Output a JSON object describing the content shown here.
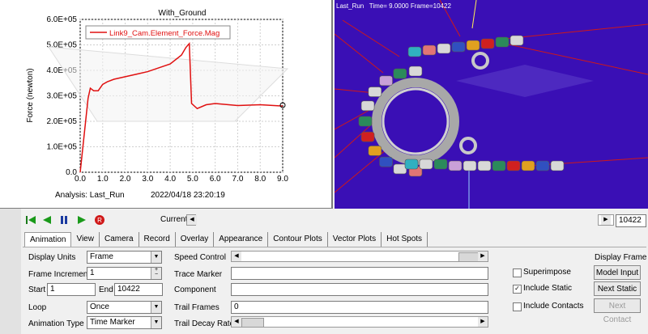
{
  "chart_data": {
    "type": "line",
    "title": "With_Ground",
    "xlabel": "",
    "ylabel": "Force (newton)",
    "xlim": [
      0,
      9
    ],
    "ylim": [
      0,
      600000
    ],
    "x_ticks": [
      "0.0",
      "1.0",
      "2.0",
      "3.0",
      "4.0",
      "5.0",
      "6.0",
      "7.0",
      "8.0",
      "9.0"
    ],
    "y_ticks": [
      "0.0",
      "1.0E+05",
      "2.0E+05",
      "3.0E+05",
      "4.0E+05",
      "5.0E+05",
      "6.0E+05"
    ],
    "legend": "top-left",
    "series": [
      {
        "name": "Link9_Cam.Element_Force.Mag",
        "x": [
          0.0,
          0.35,
          0.45,
          0.6,
          0.8,
          1.0,
          1.2,
          1.5,
          2.0,
          2.5,
          3.0,
          3.5,
          4.0,
          4.5,
          4.7,
          4.85,
          4.95,
          5.2,
          5.6,
          6.0,
          7.0,
          8.0,
          9.0
        ],
        "values": [
          0,
          290000,
          330000,
          320000,
          320000,
          345000,
          355000,
          365000,
          375000,
          385000,
          395000,
          410000,
          425000,
          460000,
          490000,
          505000,
          270000,
          250000,
          265000,
          270000,
          262000,
          265000,
          260000
        ]
      }
    ],
    "color": "#e01010"
  },
  "plot": {
    "analysis_label": "Analysis:  Last_Run",
    "timestamp": "2022-04-18 23:20:19",
    "timestamp_display": "2022/04/18 23:20:19"
  },
  "viewport": {
    "run_label": "Last_Run",
    "time_label": "Time=  9.0000",
    "frame_label": "Frame=10422"
  },
  "toolbar": {
    "current_label": "Current",
    "frame_value": "10422"
  },
  "tabs": [
    "Animation",
    "View",
    "Camera",
    "Record",
    "Overlay",
    "Appearance",
    "Contour Plots",
    "Vector Plots",
    "Hot Spots"
  ],
  "form": {
    "display_units_label": "Display Units",
    "display_units_value": "Frame",
    "frame_increment_label": "Frame Increment",
    "frame_increment_value": "1",
    "start_label": "Start",
    "start_value": "1",
    "end_label": "End",
    "end_value": "10422",
    "loop_label": "Loop",
    "loop_value": "Once",
    "animation_type_label": "Animation Type",
    "animation_type_value": "Time Marker",
    "speed_control_label": "Speed Control",
    "trace_marker_label": "Trace Marker",
    "trace_marker_value": "",
    "component_label": "Component",
    "component_value": "",
    "trail_frames_label": "Trail Frames",
    "trail_frames_value": "0",
    "trail_decay_rate_label": "Trail Decay Rate"
  },
  "options": {
    "superimpose_label": "Superimpose",
    "superimpose_checked": false,
    "include_static_label": "Include Static",
    "include_static_checked": true,
    "include_contacts_label": "Include Contacts",
    "include_contacts_checked": false
  },
  "display_frame": {
    "title": "Display Frame",
    "model_input_label": "Model Input",
    "next_static_label": "Next Static",
    "next_contact_label": "Next Contact"
  },
  "colors": {
    "viewport_bg": "#3a0fb5",
    "series": "#e01010"
  }
}
